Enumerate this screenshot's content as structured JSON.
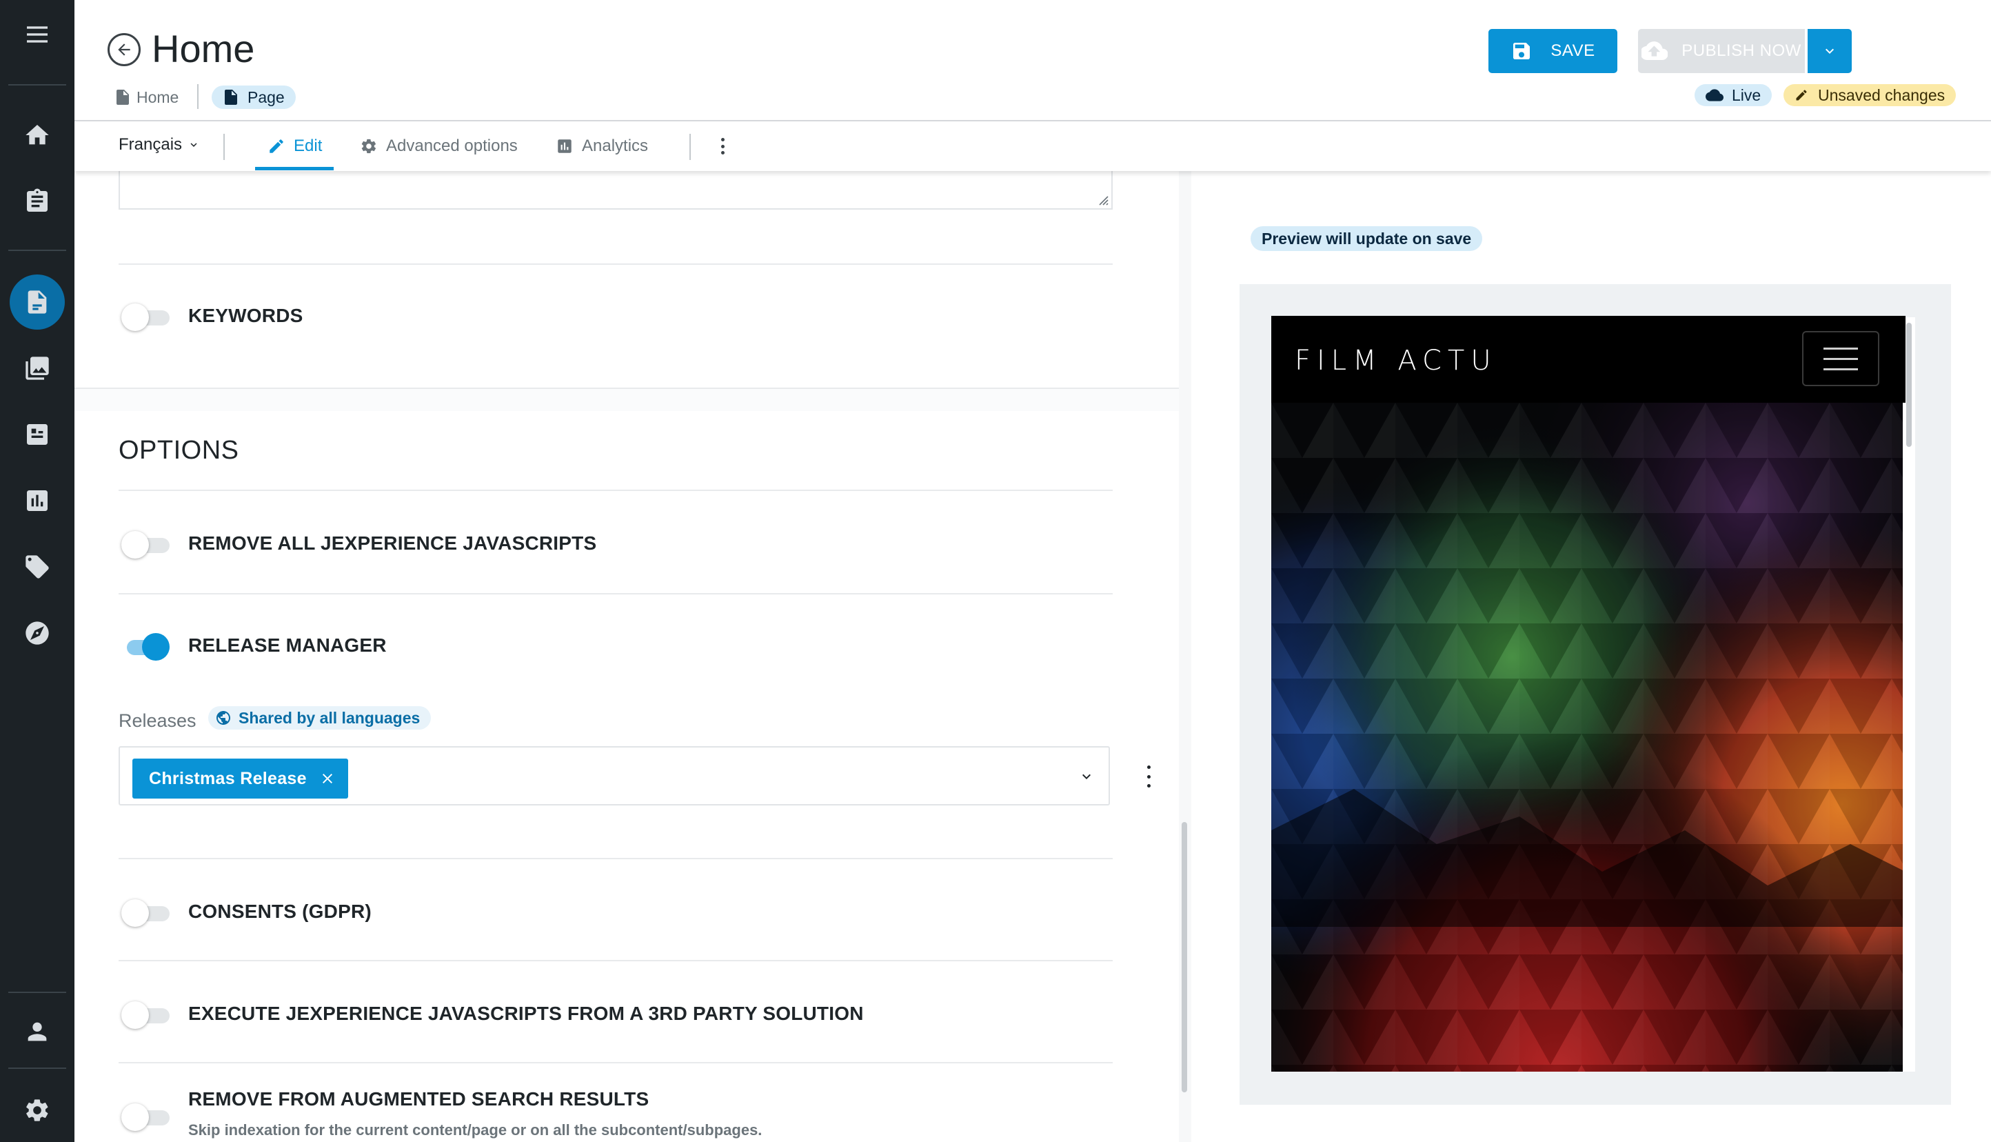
{
  "header": {
    "title": "Home",
    "breadcrumb_home": "Home",
    "breadcrumb_page": "Page",
    "save_label": "SAVE",
    "publish_label": "PUBLISH NOW",
    "status_live": "Live",
    "status_unsaved": "Unsaved changes"
  },
  "toolbar": {
    "language": "Français",
    "tabs": [
      {
        "label": "Edit",
        "icon": "pencil-icon",
        "active": true
      },
      {
        "label": "Advanced options",
        "icon": "gear-icon",
        "active": false
      },
      {
        "label": "Analytics",
        "icon": "bar-chart-icon",
        "active": false
      }
    ]
  },
  "form": {
    "keywords_label": "KEYWORDS",
    "options_title": "OPTIONS",
    "options": [
      {
        "label": "REMOVE ALL JEXPERIENCE JAVASCRIPTS",
        "enabled": false
      },
      {
        "label": "RELEASE MANAGER",
        "enabled": true
      },
      {
        "label": "CONSENTS (GDPR)",
        "enabled": false
      },
      {
        "label": "EXECUTE JEXPERIENCE JAVASCRIPTS FROM A 3RD PARTY SOLUTION",
        "enabled": false
      },
      {
        "label": "REMOVE FROM AUGMENTED SEARCH RESULTS",
        "enabled": false,
        "description": "Skip indexation for the current content/page or on all the subcontent/subpages."
      }
    ],
    "keywords_enabled": false,
    "releases": {
      "label": "Releases",
      "shared_badge": "Shared by all languages",
      "selected": [
        "Christmas Release"
      ]
    }
  },
  "preview": {
    "notice": "Preview will update on save",
    "site_title": "FILM ACTU"
  },
  "colors": {
    "accent": "#0a93d6",
    "rail_bg": "#1c2226",
    "rail_active": "#0a6ea6",
    "unsaved_bg": "#fbe9a6",
    "live_bg": "#d6ecf9"
  },
  "sidebar": {
    "icons": [
      "menu-icon",
      "home-icon",
      "clipboard-icon",
      "pages-icon",
      "image-icon",
      "content-icon",
      "analytics-icon",
      "tag-icon",
      "compass-icon",
      "user-icon",
      "settings-icon"
    ]
  }
}
